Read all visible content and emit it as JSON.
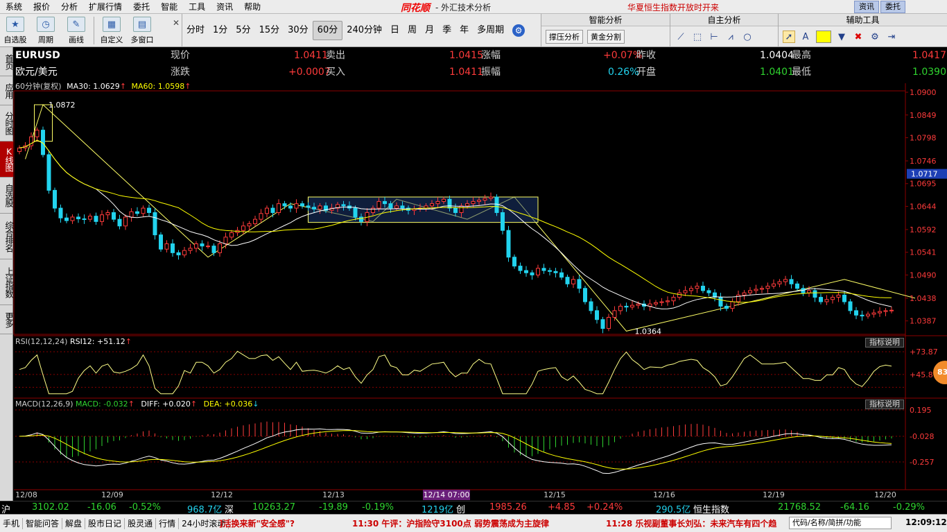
{
  "menu": [
    "系统",
    "报价",
    "分析",
    "扩展行情",
    "委托",
    "智能",
    "工具",
    "资讯",
    "帮助"
  ],
  "app": {
    "brand": "同花顺",
    "title": "- 外汇技术分析",
    "news_marquee": "华夏恒生指数开放时开来",
    "top_tabs": [
      "资讯",
      "委托"
    ]
  },
  "toolbar": {
    "left_buttons": [
      {
        "label": "自选股",
        "icon": "star-icon"
      },
      {
        "label": "周期",
        "icon": "clock-icon"
      },
      {
        "label": "画线",
        "icon": "pen-icon"
      },
      {
        "label": "自定义",
        "icon": "custom-icon"
      },
      {
        "label": "多窗口",
        "icon": "window-icon"
      }
    ],
    "periods": [
      "分时",
      "1分",
      "5分",
      "15分",
      "30分",
      "60分",
      "240分钟",
      "日",
      "周",
      "月",
      "季",
      "年",
      "多周期"
    ],
    "active_period": "60分",
    "close_glyph": "✕",
    "panels": {
      "smart": "智能分析",
      "self": "自主分析",
      "aux": "辅助工具",
      "btn_support": "撑压分析",
      "btn_golden": "黄金分割"
    }
  },
  "sidebar": [
    "首页",
    "应用",
    "分时图",
    "K线图",
    "自选股",
    "综合排名",
    "上证指数",
    "更多"
  ],
  "sidebar_active": "K线图",
  "quote": {
    "code": "EURUSD",
    "name": "欧元/美元",
    "fields": [
      {
        "label": "现价",
        "value": "1.0411",
        "color": "red"
      },
      {
        "label": "卖出",
        "value": "1.0415",
        "color": "red"
      },
      {
        "label": "涨幅",
        "value": "+0.07%",
        "color": "red"
      },
      {
        "label": "昨收",
        "value": "1.0404",
        "color": "wht"
      },
      {
        "label": "最高",
        "value": "1.0417",
        "color": "red"
      },
      {
        "label": "涨跌",
        "value": "+0.0007",
        "color": "red"
      },
      {
        "label": "买入",
        "value": "1.0411",
        "color": "red"
      },
      {
        "label": "振幅",
        "value": "0.26%",
        "color": "cyan"
      },
      {
        "label": "开盘",
        "value": "1.0401",
        "color": "grn"
      },
      {
        "label": "最低",
        "value": "1.0390",
        "color": "grn"
      }
    ]
  },
  "ma_line": {
    "period": "60分钟(复权)",
    "ma30": "MA30: 1.0629",
    "ma60": "MA60: 1.0598"
  },
  "rsi_title": {
    "name": "RSI(12,12,24)",
    "value": "RSI12: +51.12"
  },
  "macd_title": {
    "name": "MACD(12,26,9)",
    "macd": "MACD: -0.032",
    "diff": "DIFF: +0.020",
    "dea": "DEA: +0.036"
  },
  "indicator_btn": "指标说明",
  "badge": "83",
  "chart_data": {
    "type": "candlestick",
    "price_axis": {
      "ticks": [
        "1.0900",
        "1.0849",
        "1.0798",
        "1.0746",
        "1.0695",
        "1.0644",
        "1.0592",
        "1.0541",
        "1.0490",
        "1.0438",
        "1.0387"
      ],
      "current": "1.0717",
      "min": 1.036,
      "max": 1.09
    },
    "annotations": {
      "high": "1.0872",
      "low": "1.0364"
    },
    "rsi_axis": [
      "+73.87",
      "+45.87"
    ],
    "macd_axis": [
      "0.195",
      "-0.028",
      "-0.257"
    ],
    "dates": [
      "12/08",
      "12/09",
      "12/12",
      "12/13",
      "12/14 07:00",
      "12/15",
      "12/16",
      "12/19",
      "12/20"
    ],
    "crosshair_date": "12/14 07:00",
    "closes": [
      1.0775,
      1.078,
      1.08,
      1.0815,
      1.076,
      1.068,
      1.064,
      1.0618,
      1.0612,
      1.062,
      1.0616,
      1.0615,
      1.0622,
      1.061,
      1.0625,
      1.063,
      1.0615,
      1.06,
      1.062,
      1.0632,
      1.0628,
      1.064,
      1.063,
      1.058,
      1.0548,
      1.056,
      1.054,
      1.0535,
      1.0545,
      1.055,
      1.056,
      1.0555,
      1.0555,
      1.054,
      1.056,
      1.0575,
      1.0585,
      1.059,
      1.06,
      1.0605,
      1.0615,
      1.0628,
      1.064,
      1.063,
      1.065,
      1.0645,
      1.064,
      1.065,
      1.0645,
      1.0642,
      1.0638,
      1.0645,
      1.0635,
      1.064,
      1.0648,
      1.0645,
      1.064,
      1.062,
      1.061,
      1.063,
      1.064,
      1.0655,
      1.065,
      1.064,
      1.0645,
      1.064,
      1.0635,
      1.0638,
      1.064,
      1.0645,
      1.065,
      1.0655,
      1.066,
      1.064,
      1.063,
      1.0645,
      1.065,
      1.0655,
      1.0658,
      1.0662,
      1.0665,
      1.063,
      1.059,
      1.053,
      1.051,
      1.05,
      1.0495,
      1.049,
      1.0505,
      1.05,
      1.0498,
      1.0495,
      1.0485,
      1.047,
      1.048,
      1.046,
      1.043,
      1.041,
      1.039,
      1.037,
      1.0395,
      1.041,
      1.042,
      1.0418,
      1.0422,
      1.0425,
      1.042,
      1.0425,
      1.0428,
      1.043,
      1.0432,
      1.044,
      1.045,
      1.0455,
      1.046,
      1.0465,
      1.0455,
      1.045,
      1.044,
      1.042,
      1.0415,
      1.043,
      1.0445,
      1.045,
      1.0455,
      1.0458,
      1.046,
      1.0465,
      1.047,
      1.0475,
      1.048,
      1.047,
      1.046,
      1.045,
      1.0455,
      1.044,
      1.043,
      1.0435,
      1.044,
      1.0445,
      1.043,
      1.041,
      1.04,
      1.0398,
      1.0402,
      1.0405,
      1.0408,
      1.041,
      1.0411
    ]
  },
  "index_bar": {
    "sh": {
      "label": "沪",
      "price": "3102.02",
      "chg": "-16.06",
      "pct": "-0.52%",
      "amt": "968.7亿"
    },
    "sz": {
      "label": "深",
      "price": "10263.27",
      "chg": "-19.89",
      "pct": "-0.19%",
      "amt": "1219亿"
    },
    "cy": {
      "label": "创",
      "price": "1985.26",
      "chg": "+4.85",
      "pct": "+0.24%",
      "amt": "290.5亿"
    },
    "hs": {
      "label": "恒生指数",
      "price": "21768.52",
      "chg": "-64.16",
      "pct": "-0.29%"
    }
  },
  "bottom": {
    "tabs": [
      "手机",
      "智能问答",
      "解盘",
      "股市日记",
      "股灵通",
      "行情",
      "24小时滚动"
    ],
    "ticker1": "]活换来新\"安全感\"?",
    "ticker2": "11:30 午评：沪指险守3100点 弱势震荡成为主旋律",
    "ticker3": "11:28 乐视副董事长刘弘：未来汽车有四个趋",
    "search": "代码/名称/简拼/功能",
    "clock": "12:09:12"
  }
}
